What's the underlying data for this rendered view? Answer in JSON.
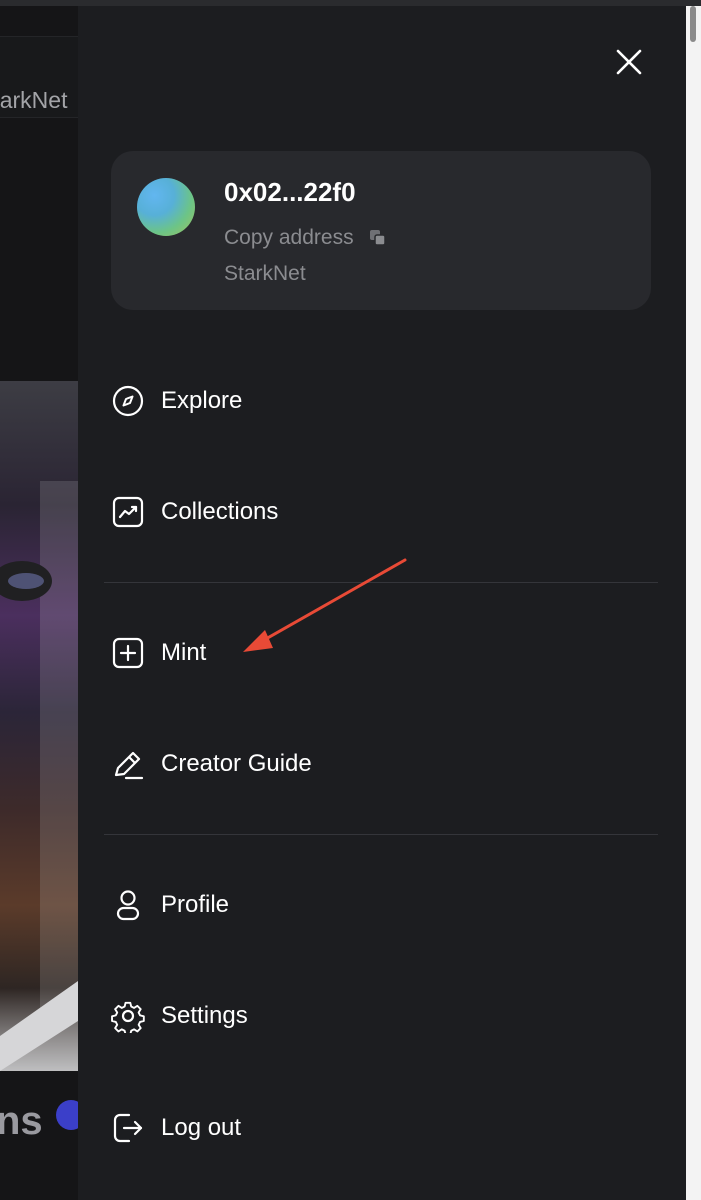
{
  "background_page": {
    "network_label": "StarkNet",
    "bottom_text": "ns"
  },
  "drawer": {
    "close_icon": "close-icon",
    "account": {
      "address": "0x02...22f0",
      "copy_label": "Copy address",
      "copy_icon": "copy-icon",
      "network": "StarkNet"
    },
    "menu": [
      {
        "label": "Explore",
        "icon": "compass-icon"
      },
      {
        "label": "Collections",
        "icon": "trending-chart-icon"
      },
      {
        "label": "Mint",
        "icon": "plus-square-icon"
      },
      {
        "label": "Creator Guide",
        "icon": "pencil-icon"
      },
      {
        "label": "Profile",
        "icon": "user-icon"
      },
      {
        "label": "Settings",
        "icon": "gear-icon"
      },
      {
        "label": "Log out",
        "icon": "logout-icon"
      }
    ]
  },
  "colors": {
    "drawer_bg": "#1c1d20",
    "card_bg": "#28292d",
    "annotation_arrow": "#e84a36"
  }
}
